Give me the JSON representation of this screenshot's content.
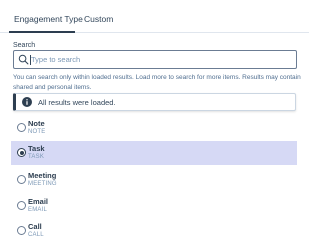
{
  "tabs": [
    {
      "label": "Engagement Type",
      "active": true
    },
    {
      "label": "Custom",
      "active": false
    }
  ],
  "search": {
    "label": "Search",
    "placeholder": "Type to search",
    "value": "",
    "icon": "search-icon"
  },
  "help_text": "You can search only within loaded results. Load more to search for more items. Results may contain shared and personal items.",
  "alert": {
    "icon": "info-icon",
    "text": "All results were loaded."
  },
  "options": [
    {
      "label": "Note",
      "value": "NOTE",
      "selected": false
    },
    {
      "label": "Task",
      "value": "TASK",
      "selected": true
    },
    {
      "label": "Meeting",
      "value": "MEETING",
      "selected": false
    },
    {
      "label": "Email",
      "value": "EMAIL",
      "selected": false
    },
    {
      "label": "Call",
      "value": "CALL",
      "selected": false
    }
  ],
  "colors": {
    "selected_row_bg": "#d6d9f5",
    "primary_text": "#33475b",
    "secondary_text": "#7c98b6",
    "accent": "#2d3e50"
  }
}
